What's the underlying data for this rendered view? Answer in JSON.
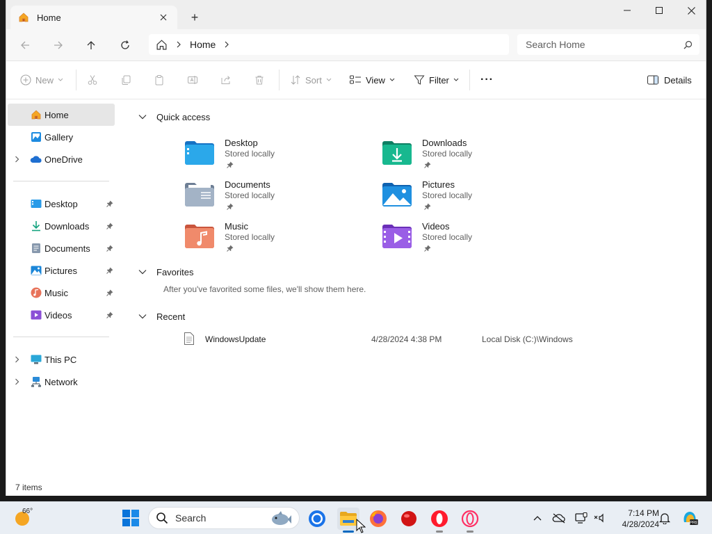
{
  "window": {
    "tab": {
      "label": "Home",
      "icon": "home-icon"
    },
    "new_tab_label": "+",
    "controls": {
      "minimize": "minimize-icon",
      "maximize": "maximize-icon",
      "close": "close-icon"
    }
  },
  "navbar": {
    "breadcrumb": [
      "Home"
    ],
    "search_placeholder": "Search Home"
  },
  "commands": {
    "new": "New",
    "sort": "Sort",
    "view": "View",
    "filter": "Filter",
    "more": "···",
    "details": "Details"
  },
  "sidebar": {
    "top": [
      {
        "label": "Home",
        "icon": "home-icon",
        "selected": true
      },
      {
        "label": "Gallery",
        "icon": "gallery-icon"
      },
      {
        "label": "OneDrive",
        "icon": "onedrive-icon",
        "expandable": true
      }
    ],
    "pinned": [
      {
        "label": "Desktop",
        "icon": "desktop-folder-icon"
      },
      {
        "label": "Downloads",
        "icon": "downloads-icon"
      },
      {
        "label": "Documents",
        "icon": "documents-icon"
      },
      {
        "label": "Pictures",
        "icon": "pictures-icon"
      },
      {
        "label": "Music",
        "icon": "music-icon"
      },
      {
        "label": "Videos",
        "icon": "videos-icon"
      }
    ],
    "bottom": [
      {
        "label": "This PC",
        "icon": "this-pc-icon",
        "expandable": true
      },
      {
        "label": "Network",
        "icon": "network-icon",
        "expandable": true
      }
    ]
  },
  "main": {
    "quick_access": {
      "title": "Quick access",
      "items": [
        {
          "name": "Desktop",
          "sub": "Stored locally",
          "icon": "desktop-folder-icon",
          "color": "#1e88d6"
        },
        {
          "name": "Downloads",
          "sub": "Stored locally",
          "icon": "downloads-folder-icon",
          "color": "#14a37f"
        },
        {
          "name": "Documents",
          "sub": "Stored locally",
          "icon": "documents-folder-icon",
          "color": "#7a8fa8"
        },
        {
          "name": "Pictures",
          "sub": "Stored locally",
          "icon": "pictures-folder-icon",
          "color": "#1b86d8"
        },
        {
          "name": "Music",
          "sub": "Stored locally",
          "icon": "music-folder-icon",
          "color": "#e8735a"
        },
        {
          "name": "Videos",
          "sub": "Stored locally",
          "icon": "videos-folder-icon",
          "color": "#8b4fd6"
        }
      ]
    },
    "favorites": {
      "title": "Favorites",
      "empty_text": "After you've favorited some files, we'll show them here."
    },
    "recent": {
      "title": "Recent",
      "items": [
        {
          "name": "WindowsUpdate",
          "date": "4/28/2024 4:38 PM",
          "location": "Local Disk (C:)\\Windows",
          "icon": "text-file-icon"
        }
      ]
    }
  },
  "status": {
    "items_count": "7 items"
  },
  "taskbar": {
    "weather_temp": "66°",
    "search_label": "Search",
    "apps": [
      "chrome-icon",
      "file-explorer-icon",
      "firefox-icon",
      "red-app-icon",
      "opera-icon",
      "opera-gx-icon"
    ],
    "clock_time": "7:14 PM",
    "clock_date": "4/28/2024"
  }
}
